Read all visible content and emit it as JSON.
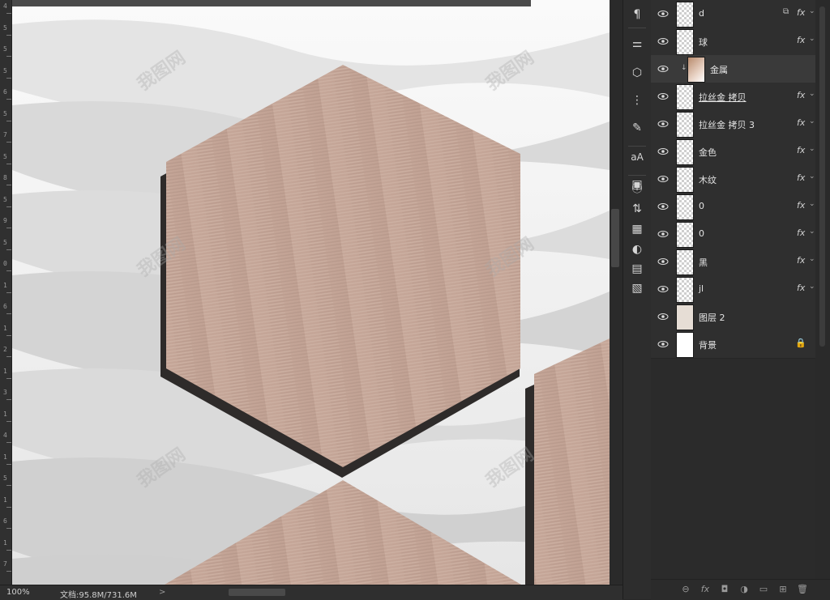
{
  "ruler": {
    "labels": [
      "4",
      "5",
      "5",
      "5",
      "6",
      "5",
      "7",
      "5",
      "8",
      "5",
      "9",
      "5",
      "0",
      "1",
      "6",
      "1",
      "2",
      "1",
      "3",
      "1",
      "4",
      "1",
      "5",
      "1",
      "6",
      "1",
      "7"
    ]
  },
  "status": {
    "zoom": "100%",
    "doc_info": "文档:95.8M/731.6M",
    "arrow": ">"
  },
  "tools": [
    "paragraph-icon",
    "adjust-icon",
    "3d-cube-icon",
    "align-icon",
    "brush-icon",
    "character-icon",
    "navigator-icon",
    "info-icon",
    "history-icon",
    "table-icon",
    "style-icon",
    "properties-icon",
    "notes-icon"
  ],
  "layers": [
    {
      "name": "d",
      "thumb": "transparent",
      "fx": "fx",
      "link": "⧉"
    },
    {
      "name": "球",
      "thumb": "transparent",
      "fx": "fx"
    },
    {
      "name": "金属",
      "thumb": "copper",
      "clipped": true,
      "selected": true
    },
    {
      "name": "拉丝金  拷贝",
      "thumb": "transparent",
      "fx": "fx",
      "underline": true
    },
    {
      "name": "拉丝金  拷贝 3",
      "thumb": "transparent",
      "fx": "fx"
    },
    {
      "name": "金色",
      "thumb": "transparent",
      "fx": "fx"
    },
    {
      "name": "木纹",
      "thumb": "transparent",
      "fx": "fx"
    },
    {
      "name": "0",
      "thumb": "transparent",
      "fx": "fx"
    },
    {
      "name": "0",
      "thumb": "transparent",
      "fx": "fx"
    },
    {
      "name": "黑",
      "thumb": "transparent",
      "fx": "fx"
    },
    {
      "name": "jl",
      "thumb": "transparent",
      "fx": "fx"
    },
    {
      "name": "图层 2",
      "thumb": "beige"
    },
    {
      "name": "背景",
      "thumb": "white",
      "locked": true
    }
  ],
  "footer": [
    "link-icon",
    "fx-icon",
    "mask-icon",
    "adjustment-icon",
    "folder-icon",
    "new-layer-icon",
    "trash-icon"
  ],
  "colors": {
    "hexagon": "#c8aa9c",
    "hex_shadow": "#2e2b2a",
    "panel": "#2b2b2b"
  },
  "watermark": "我图网"
}
